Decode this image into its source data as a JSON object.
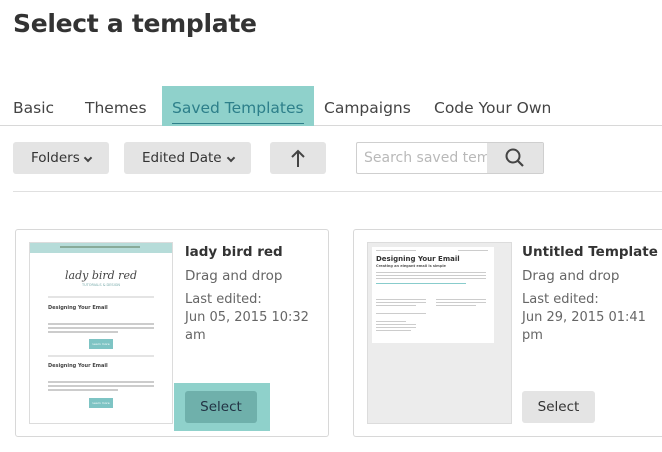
{
  "page": {
    "title": "Select a template"
  },
  "tabs": [
    {
      "label": "Basic",
      "active": false
    },
    {
      "label": "Themes",
      "active": false
    },
    {
      "label": "Saved Templates",
      "active": true
    },
    {
      "label": "Campaigns",
      "active": false
    },
    {
      "label": "Code Your Own",
      "active": false
    }
  ],
  "toolbar": {
    "folders_label": "Folders",
    "sort_label": "Edited Date",
    "search_placeholder": "Search saved templates"
  },
  "templates": [
    {
      "name": "lady bird red",
      "type": "Drag and drop",
      "edited_label": "Last edited:",
      "edited_date": "Jun 05, 2015 10:32 am",
      "select_label": "Select",
      "preview": {
        "brand": "lady bird red",
        "tagline": "TUTORIALS & DESIGN",
        "heading_1": "Designing Your Email",
        "heading_2": "Designing Your Email",
        "button_1": "Learn more",
        "button_2": "Learn more"
      }
    },
    {
      "name": "Untitled Template",
      "type": "Drag and drop",
      "edited_label": "Last edited:",
      "edited_date": "Jun 29, 2015 01:41 pm",
      "select_label": "Select",
      "preview": {
        "heading": "Designing Your Email",
        "subheading": "Creating an elegant email is simple"
      }
    }
  ],
  "colors": {
    "accent": "#8fd1cb",
    "accent_text": "#2d7f8a",
    "button": "#e4e4e4"
  },
  "icons": {
    "dropdown": "chevron-down-icon",
    "sort": "arrow-up-icon",
    "search": "search-icon"
  }
}
